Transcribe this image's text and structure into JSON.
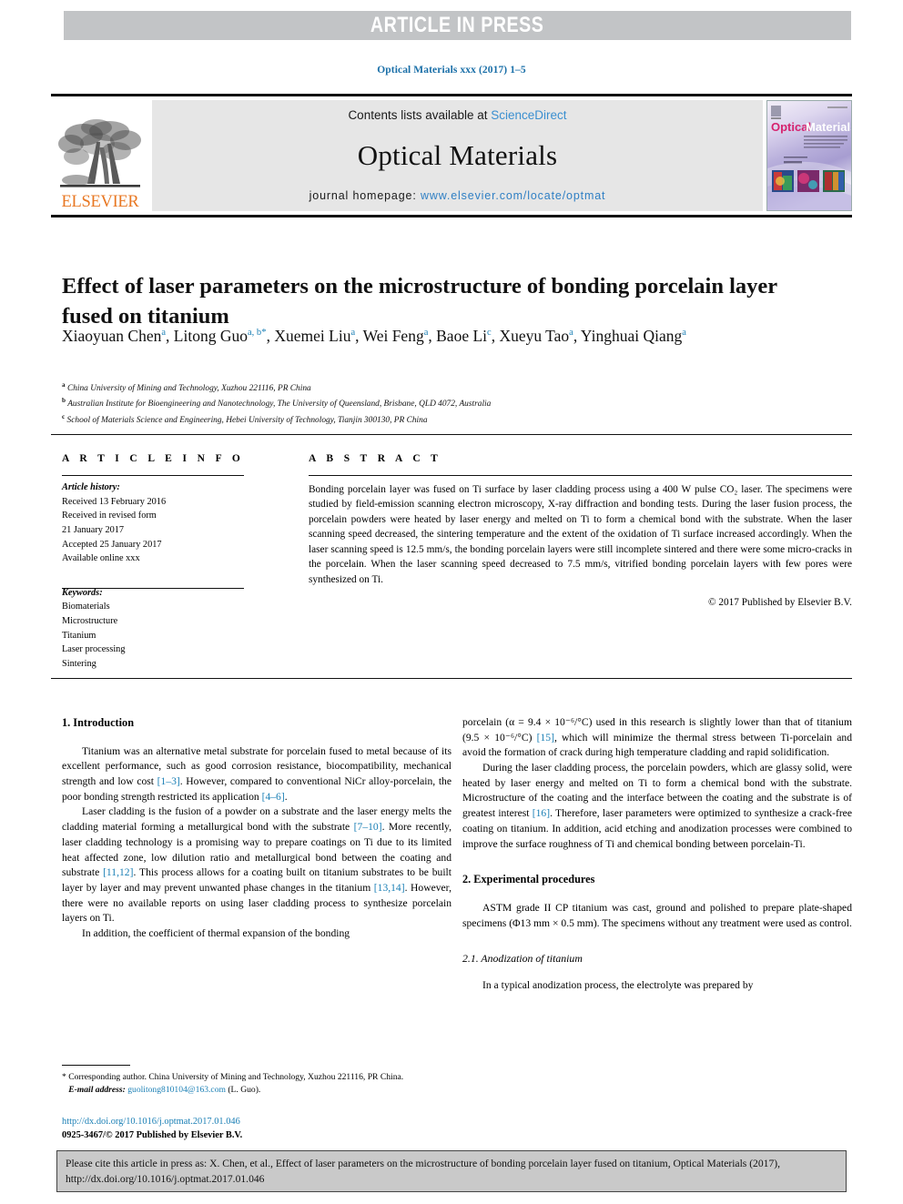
{
  "banner": {
    "text": "ARTICLE IN PRESS",
    "bg_color": "#c2c4c6",
    "text_color": "#ffffff"
  },
  "running_head": {
    "text": "Optical Materials xxx (2017) 1–5",
    "color": "#1a6fa8"
  },
  "masthead": {
    "publisher": "ELSEVIER",
    "publisher_color": "#e87722",
    "contents_prefix": "Contents lists available at ",
    "contents_link": "ScienceDirect",
    "journal_name": "Optical Materials",
    "homepage_prefix": "journal homepage: ",
    "homepage_url": "www.elsevier.com/locate/optmat",
    "link_color": "#3a8fd0",
    "cover": {
      "title_word1": "Optical",
      "title_word2": "Materials",
      "word1_color": "#d6226f",
      "word2_color": "#ffffff"
    }
  },
  "article": {
    "title": "Effect of laser parameters on the microstructure of bonding porcelain layer fused on titanium",
    "authors": [
      {
        "name": "Xiaoyuan Chen",
        "marks": "a",
        "star": false,
        "sep": ", "
      },
      {
        "name": "Litong Guo",
        "marks": "a, b",
        "star": true,
        "sep": ", "
      },
      {
        "name": "Xuemei Liu",
        "marks": "a",
        "star": false,
        "sep": ", "
      },
      {
        "name": "Wei Feng",
        "marks": "a",
        "star": false,
        "sep": ", "
      },
      {
        "name": "Baoe Li",
        "marks": "c",
        "star": false,
        "sep": ", "
      },
      {
        "name": "Xueyu Tao",
        "marks": "a",
        "star": false,
        "sep": ", "
      },
      {
        "name": "Yinghuai Qiang",
        "marks": "a",
        "star": false,
        "sep": ""
      }
    ],
    "affiliations": [
      {
        "mark": "a",
        "text": "China University of Mining and Technology, Xuzhou 221116, PR China"
      },
      {
        "mark": "b",
        "text": "Australian Institute for Bioengineering and Nanotechnology, The University of Queensland, Brisbane, QLD 4072, Australia"
      },
      {
        "mark": "c",
        "text": "School of Materials Science and Engineering, Hebei University of Technology, Tianjin 300130, PR China"
      }
    ]
  },
  "info": {
    "heading": "A R T I C L E  I N F O",
    "history_label": "Article history:",
    "history": [
      "Received 13 February 2016",
      "Received in revised form",
      "21 January 2017",
      "Accepted 25 January 2017",
      "Available online xxx"
    ],
    "keywords_label": "Keywords:",
    "keywords": [
      "Biomaterials",
      "Microstructure",
      "Titanium",
      "Laser processing",
      "Sintering"
    ]
  },
  "abstract": {
    "heading": "A B S T R A C T",
    "body": "Bonding porcelain layer was fused on Ti surface by laser cladding process using a 400 W pulse CO₂ laser. The specimens were studied by field-emission scanning electron microscopy, X-ray diffraction and bonding tests. During the laser fusion process, the porcelain powders were heated by laser energy and melted on Ti to form a chemical bond with the substrate. When the laser scanning speed decreased, the sintering temperature and the extent of the oxidation of Ti surface increased accordingly. When the laser scanning speed is 12.5 mm/s, the bonding porcelain layers were still incomplete sintered and there were some micro-cracks in the porcelain. When the laser scanning speed decreased to 7.5 mm/s, vitrified bonding porcelain layers with few pores were synthesized on Ti.",
    "copyright": "© 2017 Published by Elsevier B.V."
  },
  "body": {
    "left": {
      "section_heading": "1. Introduction",
      "paragraphs": [
        "Titanium was an alternative metal substrate for porcelain fused to metal because of its excellent performance, such as good corrosion resistance, biocompatibility, mechanical strength and low cost [1–3]. However, compared to conventional NiCr alloy-porcelain, the poor bonding strength restricted its application [4–6].",
        "Laser cladding is the fusion of a powder on a substrate and the laser energy melts the cladding material forming a metallurgical bond with the substrate [7–10]. More recently, laser cladding technology is a promising way to prepare coatings on Ti due to its limited heat affected zone, low dilution ratio and metallurgical bond between the coating and substrate [11,12]. This process allows for a coating built on titanium substrates to be built layer by layer and may prevent unwanted phase changes in the titanium [13,14]. However, there were no available reports on using laser cladding process to synthesize porcelain layers on Ti.",
        "In addition, the coefficient of thermal expansion of the bonding"
      ]
    },
    "right": {
      "paragraphs": [
        "porcelain (α = 9.4 × 10⁻⁶/°C) used in this research is slightly lower than that of titanium (9.5 × 10⁻⁶/°C) [15], which will minimize the thermal stress between Ti-porcelain and avoid the formation of crack during high temperature cladding and rapid solidification.",
        "During the laser cladding process, the porcelain powders, which are glassy solid, were heated by laser energy and melted on Ti to form a chemical bond with the substrate. Microstructure of the coating and the interface between the coating and the substrate is of greatest interest [16]. Therefore, laser parameters were optimized to synthesize a crack-free coating on titanium. In addition, acid etching and anodization processes were combined to improve the surface roughness of Ti and chemical bonding between porcelain-Ti."
      ],
      "section_heading": "2. Experimental procedures",
      "section_paragraph": "ASTM grade II CP titanium was cast, ground and polished to prepare plate-shaped specimens (Φ13 mm × 0.5 mm). The specimens without any treatment were used as control.",
      "subsection_heading": "2.1. Anodization of titanium",
      "subsection_paragraph": "In a typical anodization process, the electrolyte was prepared by"
    }
  },
  "footnote": {
    "marker": "*",
    "corresponding": "Corresponding author. China University of Mining and Technology, Xuzhou 221116, PR China.",
    "email_label": "E-mail address:",
    "email": "guolitong810104@163.com",
    "email_owner": "(L. Guo).",
    "doi_url": "http://dx.doi.org/10.1016/j.optmat.2017.01.046",
    "issn_line": "0925-3467/© 2017 Published by Elsevier B.V.",
    "link_color": "#1a7fb5"
  },
  "citation_box": {
    "text": "Please cite this article in press as: X. Chen, et al., Effect of laser parameters on the microstructure of bonding porcelain layer fused on titanium, Optical Materials (2017), http://dx.doi.org/10.1016/j.optmat.2017.01.046",
    "bg_color": "#c9c9c9"
  }
}
